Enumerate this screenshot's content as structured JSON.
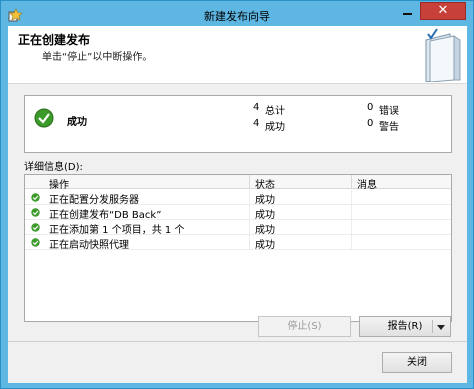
{
  "window": {
    "title": "新建发布向导"
  },
  "titlebar": {
    "close_glyph": "✕"
  },
  "header": {
    "title": "正在创建发布",
    "subtitle": "单击“停止”以中断操作。"
  },
  "summary": {
    "status": "成功",
    "total_count": "4",
    "total_label": "总计",
    "success_count": "4",
    "success_label": "成功",
    "error_count": "0",
    "error_label": "错误",
    "warning_count": "0",
    "warning_label": "警告"
  },
  "details": {
    "label": "详细信息(D):",
    "columns": [
      "操作",
      "状态",
      "消息"
    ],
    "rows": [
      {
        "action": "正在配置分发服务器",
        "status": "成功",
        "message": ""
      },
      {
        "action": "正在创建发布“DB Back”",
        "status": "成功",
        "message": ""
      },
      {
        "action": "正在添加第 1 个项目，共 1 个",
        "status": "成功",
        "message": ""
      },
      {
        "action": "正在启动快照代理",
        "status": "成功",
        "message": ""
      }
    ]
  },
  "buttons": {
    "stop": "停止(S)",
    "report": "报告(R)",
    "close": "关闭"
  },
  "icons": {
    "app": "wizard-app-icon",
    "success": "green-check-circle-icon",
    "header_graphic": "book-with-checkmark-icon"
  },
  "colors": {
    "titlebar": "#5eb6e3",
    "close_button": "#c7403a",
    "success_green": "#3c9a2a"
  }
}
